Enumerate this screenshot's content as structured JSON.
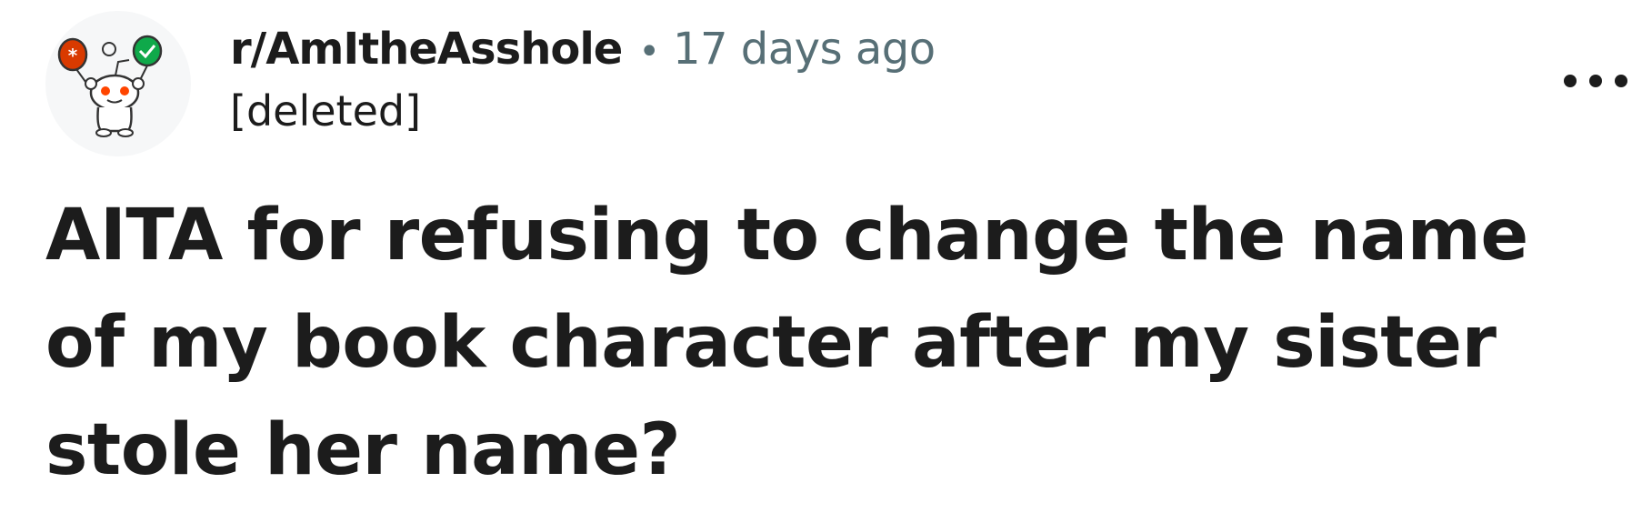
{
  "post": {
    "subreddit": "r/AmItheAsshole",
    "separator": "•",
    "timestamp": "17 days ago",
    "author": "[deleted]",
    "title": "AITA for refusing to change the name of my book character after my sister stole her name?",
    "more_label": "•••"
  },
  "icons": {
    "avatar": "snoo-avatar-icon",
    "more": "more-options-icon"
  },
  "colors": {
    "text_primary": "#1c1c1c",
    "text_secondary": "#576f76",
    "avatar_background": "#f6f7f8",
    "balloon_orange": "#d93a00",
    "balloon_green": "#0fa94a"
  }
}
